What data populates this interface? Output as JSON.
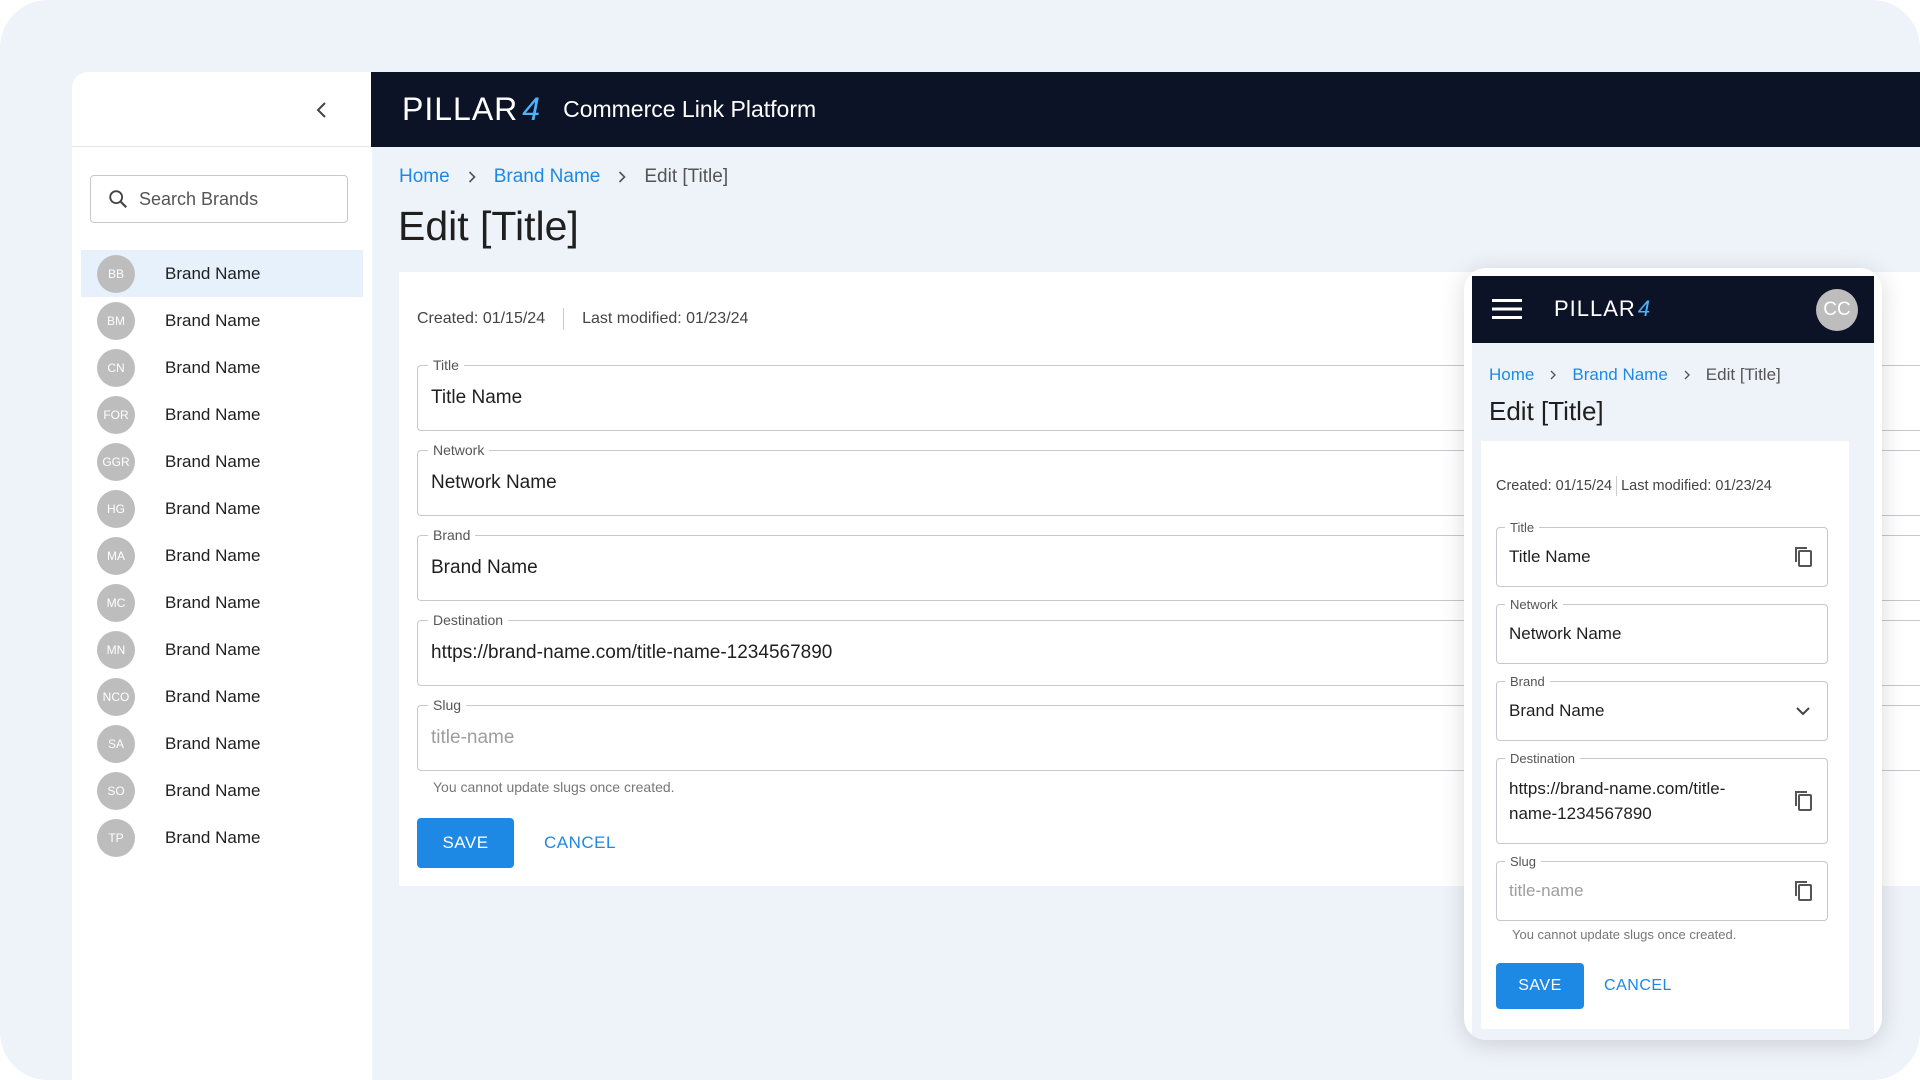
{
  "app": {
    "logo_text": "PILLAR",
    "logo_mark": "4",
    "title": "Commerce Link Platform"
  },
  "sidebar": {
    "search_placeholder": "Search Brands",
    "brands": [
      {
        "initials": "BB",
        "name": "Brand Name"
      },
      {
        "initials": "BM",
        "name": "Brand Name"
      },
      {
        "initials": "CN",
        "name": "Brand Name"
      },
      {
        "initials": "FOR",
        "name": "Brand Name"
      },
      {
        "initials": "GGR",
        "name": "Brand Name"
      },
      {
        "initials": "HG",
        "name": "Brand Name"
      },
      {
        "initials": "MA",
        "name": "Brand Name"
      },
      {
        "initials": "MC",
        "name": "Brand Name"
      },
      {
        "initials": "MN",
        "name": "Brand Name"
      },
      {
        "initials": "NCO",
        "name": "Brand Name"
      },
      {
        "initials": "SA",
        "name": "Brand Name"
      },
      {
        "initials": "SO",
        "name": "Brand Name"
      },
      {
        "initials": "TP",
        "name": "Brand Name"
      }
    ]
  },
  "breadcrumb": {
    "home": "Home",
    "brand": "Brand  Name",
    "current": "Edit [Title]"
  },
  "page": {
    "title": "Edit [Title]",
    "created": "Created: 01/15/24",
    "modified": "Last modified: 01/23/24"
  },
  "form": {
    "title_label": "Title",
    "title_value": "Title Name",
    "network_label": "Network",
    "network_value": "Network Name",
    "brand_label": "Brand",
    "brand_value": "Brand Name",
    "destination_label": "Destination",
    "destination_value": "https://brand-name.com/title-name-1234567890",
    "slug_label": "Slug",
    "slug_value": "title-name",
    "slug_helper": "You cannot update slugs once created.",
    "save_label": "SAVE",
    "cancel_label": "CANCEL"
  },
  "mobile": {
    "avatar": "CC",
    "breadcrumb_brand": "Brand Name",
    "destination_value": "https://brand-name.com/title-name-1234567890"
  },
  "colors": {
    "accent": "#1e88e5",
    "header": "#0c1326",
    "background": "#eef3f9"
  }
}
